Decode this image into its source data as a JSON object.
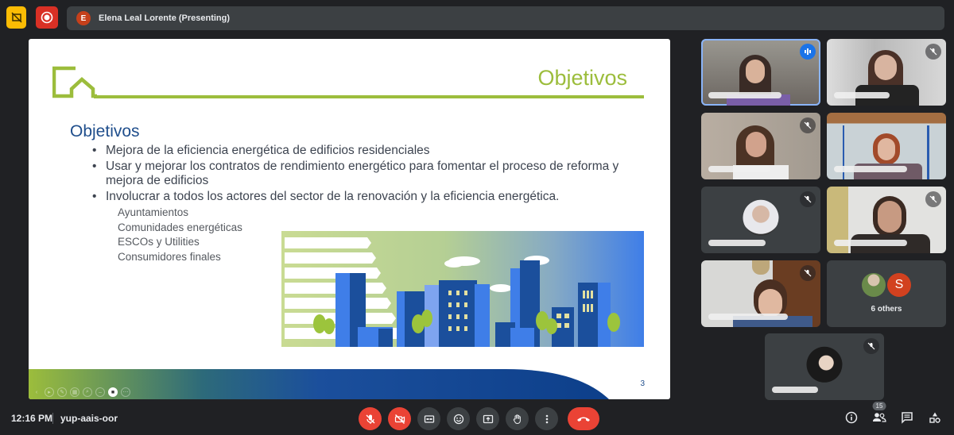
{
  "topbar": {
    "presenter_initial": "E",
    "presenter_label": "Elena Leal Lorente (Presenting)",
    "icons": [
      "presentation-off-icon",
      "record-icon"
    ]
  },
  "slide": {
    "title": "Objetivos",
    "heading": "Objetivos",
    "bullets": [
      "Mejora de la eficiencia energética de edificios residenciales",
      "Usar y mejorar los contratos de rendimiento energético para fomentar el proceso de reforma y mejora de edificios",
      "Involucrar a todos los actores del sector de la renovación y la eficiencia energética."
    ],
    "subitems": [
      "Ayuntamientos",
      "Comunidades energéticas",
      "ESCOs y Utilities",
      "Consumidores finales"
    ],
    "page_number": "3",
    "colors": {
      "accent_green": "#9cbd3c",
      "accent_blue": "#1f4e8c"
    }
  },
  "participants": {
    "tiles": [
      {
        "id": "p1",
        "speaking": true,
        "muted": false
      },
      {
        "id": "p2",
        "speaking": false,
        "muted": true
      },
      {
        "id": "p3",
        "speaking": false,
        "muted": true
      },
      {
        "id": "p4",
        "speaking": false,
        "muted": false
      },
      {
        "id": "p5",
        "speaking": false,
        "muted": true
      },
      {
        "id": "p6",
        "speaking": false,
        "muted": true
      },
      {
        "id": "p7",
        "speaking": false,
        "muted": true
      },
      {
        "id": "p8",
        "speaking": false,
        "muted": true
      }
    ],
    "others": {
      "initial": "S",
      "label": "6 others"
    }
  },
  "bottombar": {
    "time": "12:16 PM",
    "meeting_code": "yup-aais-oor",
    "participant_count": "15",
    "controls": [
      "mic-off",
      "camera-off",
      "captions",
      "emoji",
      "present",
      "raise-hand",
      "more-options",
      "end-call"
    ]
  }
}
